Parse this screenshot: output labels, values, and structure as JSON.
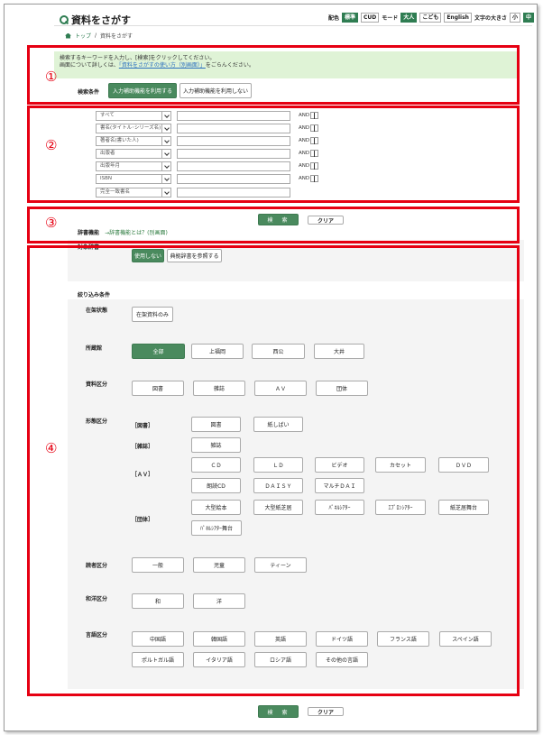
{
  "header": {
    "title": "資料をさがす",
    "display_label": "配色",
    "chips": [
      {
        "label": "標準",
        "active": true
      },
      {
        "label": "CUD",
        "active": false
      },
      {
        "label": "モード",
        "active": false,
        "plain": true
      },
      {
        "label": "大人",
        "active": true
      },
      {
        "label": "こども",
        "active": false
      },
      {
        "label": "English",
        "active": false
      },
      {
        "label": "文字の大きさ",
        "active": false,
        "plain": true
      },
      {
        "label": "小",
        "active": false
      },
      {
        "label": "中",
        "active": true
      }
    ]
  },
  "breadcrumb": {
    "home": "トップ",
    "sep": "/",
    "current": "資料をさがす"
  },
  "markers": [
    "①",
    "②",
    "③",
    "④"
  ],
  "notice": {
    "line1": "検索するキーワードを入力し、[検索]をクリックしてください。",
    "line2_pre": "画面について詳しくは、",
    "line2_link": "「資料をさがすの使い方（別画面）」",
    "line2_post": "をごらんください。"
  },
  "condition": {
    "label": "検索条件",
    "use_helper": "入力補助機能を利用する",
    "no_helper": "入力補助機能を利用しない"
  },
  "fields": [
    {
      "select": "すべて",
      "op": "AND"
    },
    {
      "select": "書名(タイトル･シリーズ名)",
      "op": "AND"
    },
    {
      "select": "著者名(書いた人)",
      "op": "AND"
    },
    {
      "select": "出版者",
      "op": "AND"
    },
    {
      "select": "出版年月",
      "op": "AND"
    },
    {
      "select": "ISBN",
      "op": "AND"
    },
    {
      "select": "完全一致書名",
      "op": ""
    }
  ],
  "actions": {
    "search": "検　索",
    "clear": "クリア"
  },
  "dictionary": {
    "label": "辞書機能",
    "link": "→辞書機能とは？(別画面)",
    "target_label": "対象辞書",
    "not_use": "使用しない",
    "refer": "典拠辞書を参照する"
  },
  "filters": {
    "heading": "絞り込み条件",
    "shelf": {
      "label": "在架状態",
      "options": [
        "在架資料のみ"
      ]
    },
    "library": {
      "label": "所蔵館",
      "options": [
        "全部",
        "上福岡",
        "西公",
        "大井"
      ]
    },
    "material": {
      "label": "資料区分",
      "options": [
        "図書",
        "雑誌",
        "ＡＶ",
        "団体"
      ]
    },
    "form": {
      "label": "形態区分",
      "groups": [
        {
          "label": "［図書］",
          "options": [
            "図書",
            "紙しばい"
          ]
        },
        {
          "label": "［雑誌］",
          "options": [
            "雑誌"
          ]
        },
        {
          "label": "［ＡＶ］",
          "options": [
            "ＣＤ",
            "ＬＤ",
            "ビデオ",
            "カセット",
            "ＤＶＤ",
            "朗読CD",
            "ＤＡＩＳＹ",
            "マルチＤＡＩ"
          ]
        },
        {
          "label": "［団体］",
          "options": [
            "大型絵本",
            "大型紙芝居",
            "ﾊﾟﾈﾙｼｱﾀｰ",
            "ｴﾌﾟﾛﾝｼｱﾀｰ",
            "紙芝居舞台",
            "ﾊﾟﾈﾙｼｱﾀｰ舞台"
          ]
        }
      ]
    },
    "reader": {
      "label": "読者区分",
      "options": [
        "一般",
        "児童",
        "ティーン"
      ]
    },
    "jpwest": {
      "label": "和洋区分",
      "options": [
        "和",
        "洋"
      ]
    },
    "language": {
      "label": "言語区分",
      "options": [
        "中国語",
        "韓国語",
        "英語",
        "ドイツ語",
        "フランス語",
        "スペイン語",
        "ポルトガル語",
        "イタリア語",
        "ロシア語",
        "その他の言語"
      ]
    }
  },
  "colors": {
    "accent": "#2f7d52",
    "marker": "#e60012",
    "notice_bg": "#dff3d6"
  }
}
